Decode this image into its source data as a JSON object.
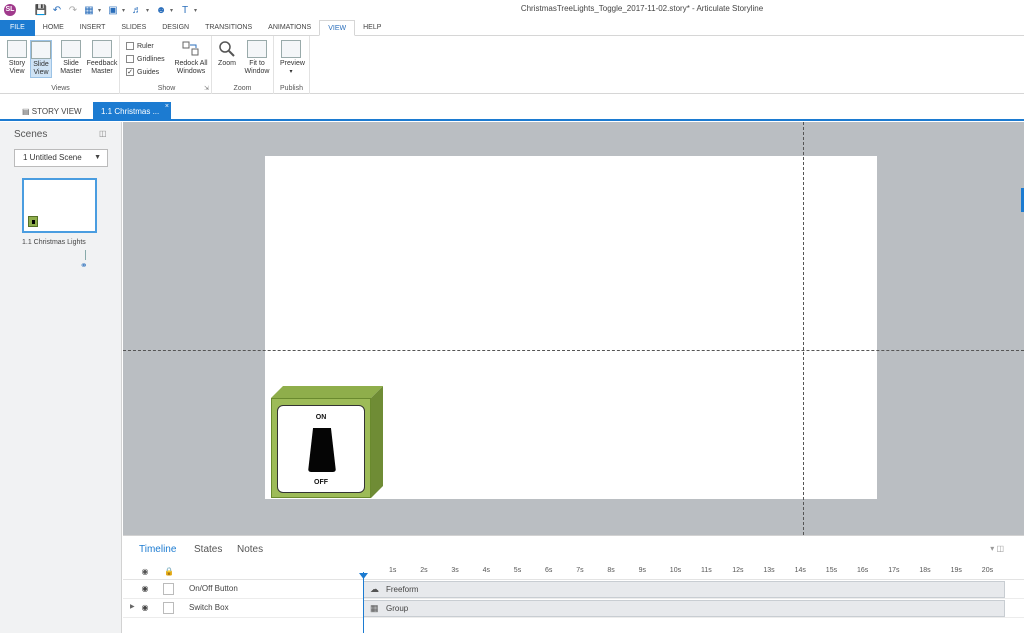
{
  "window": {
    "title": "ChristmasTreeLights_Toggle_2017-11-02.story* - Articulate Storyline",
    "logo_text": "SL"
  },
  "ribbon_tabs": [
    "FILE",
    "HOME",
    "INSERT",
    "SLIDES",
    "DESIGN",
    "TRANSITIONS",
    "ANIMATIONS",
    "VIEW",
    "HELP"
  ],
  "active_tab": "VIEW",
  "ribbon": {
    "views_group": {
      "label": "Views",
      "buttons": [
        {
          "label": "Story View"
        },
        {
          "label": "Slide View"
        },
        {
          "label": "Slide Master"
        },
        {
          "label": "Feedback Master"
        }
      ]
    },
    "show_group": {
      "label": "Show",
      "checkboxes": [
        {
          "label": "Ruler",
          "checked": false
        },
        {
          "label": "Gridlines",
          "checked": false
        },
        {
          "label": "Guides",
          "checked": true
        }
      ],
      "redock_label": "Redock All Windows"
    },
    "zoom_group": {
      "label": "Zoom",
      "buttons": [
        {
          "label": "Zoom"
        },
        {
          "label": "Fit to Window"
        }
      ]
    },
    "publish_group": {
      "label": "Publish",
      "preview_label": "Preview"
    }
  },
  "doc_tabs": {
    "story_view": "STORY VIEW",
    "slide_tab": "1.1 Christmas ..."
  },
  "scenes_panel": {
    "title": "Scenes",
    "scene_select": "1 Untitled Scene",
    "slide_label": "1.1 Christmas Lights"
  },
  "slide": {
    "switch_on": "ON",
    "switch_off": "OFF"
  },
  "timeline": {
    "tabs": [
      "Timeline",
      "States",
      "Notes"
    ],
    "active_tab": "Timeline",
    "ruler": [
      "1s",
      "2s",
      "3s",
      "4s",
      "5s",
      "6s",
      "7s",
      "8s",
      "9s",
      "10s",
      "11s",
      "12s",
      "13s",
      "14s",
      "15s",
      "16s",
      "17s",
      "18s",
      "19s",
      "20s"
    ],
    "rows": [
      {
        "name": "On/Off Button",
        "bar_label": "Freeform",
        "bar_icon": "freeform-icon",
        "expandable": false
      },
      {
        "name": "Switch Box",
        "bar_label": "Group",
        "bar_icon": "group-icon",
        "expandable": true
      }
    ]
  },
  "colors": {
    "accent": "#1c7bd1",
    "canvas_bg": "#babec2",
    "switch_green": "#9dbb58"
  }
}
